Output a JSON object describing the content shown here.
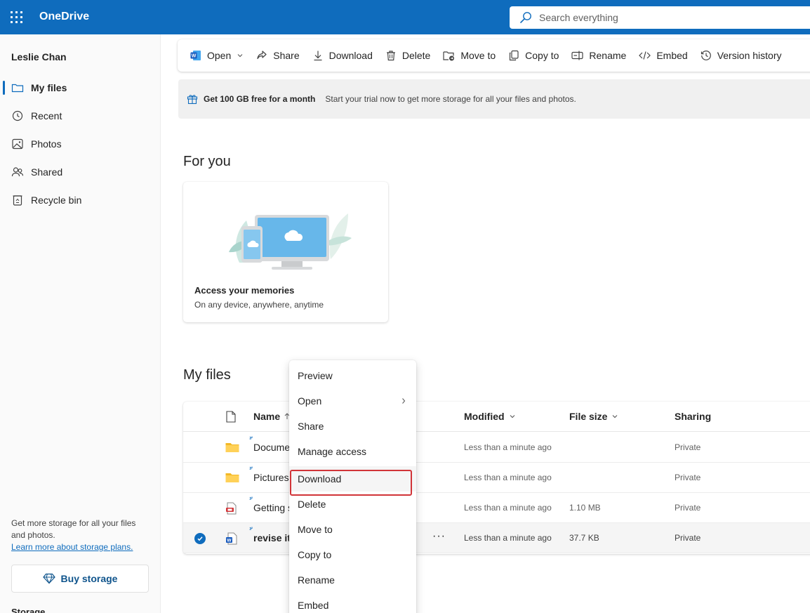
{
  "app": {
    "name": "OneDrive",
    "waffle_icon": "app-launcher-icon",
    "brand_color": "#0f6cbd"
  },
  "search": {
    "placeholder": "Search everything"
  },
  "sidebar": {
    "user_name": "Leslie Chan",
    "items": [
      {
        "label": "My files",
        "icon": "folder-icon",
        "active": true
      },
      {
        "label": "Recent",
        "icon": "history-icon",
        "active": false
      },
      {
        "label": "Photos",
        "icon": "image-icon",
        "active": false
      },
      {
        "label": "Shared",
        "icon": "people-icon",
        "active": false
      },
      {
        "label": "Recycle bin",
        "icon": "recycle-bin-icon",
        "active": false
      }
    ],
    "storage_text": "Get more storage for all your files and photos.",
    "storage_link": "Learn more about storage plans.",
    "buy_label": "Buy storage",
    "storage_heading": "Storage"
  },
  "toolbar": {
    "open": "Open",
    "share": "Share",
    "download": "Download",
    "delete": "Delete",
    "move_to": "Move to",
    "copy_to": "Copy to",
    "rename": "Rename",
    "embed": "Embed",
    "version_history": "Version history"
  },
  "banner": {
    "title": "Get 100 GB free for a month",
    "text": "Start your trial now to get more storage for all your files and photos."
  },
  "for_you": {
    "heading": "For you",
    "card_title": "Access your memories",
    "card_subtitle": "On any device, anywhere, anytime"
  },
  "my_files": {
    "heading": "My files",
    "columns": {
      "name": "Name",
      "modified": "Modified",
      "file_size": "File size",
      "sharing": "Sharing"
    },
    "rows": [
      {
        "name": "Docume",
        "type": "folder",
        "modified": "Less than a minute ago",
        "size": "",
        "sharing": "Private",
        "selected": false
      },
      {
        "name": "Pictures",
        "type": "folder",
        "modified": "Less than a minute ago",
        "size": "",
        "sharing": "Private",
        "selected": false
      },
      {
        "name": "Getting s",
        "type": "pdf",
        "modified": "Less than a minute ago",
        "size": "1.10 MB",
        "sharing": "Private",
        "selected": false
      },
      {
        "name": "revise it.",
        "type": "word",
        "modified": "Less than a minute ago",
        "size": "37.7 KB",
        "sharing": "Private",
        "selected": true
      }
    ],
    "more_label": "···"
  },
  "context_menu": {
    "items": [
      {
        "label": "Preview",
        "submenu": false,
        "highlighted": false
      },
      {
        "label": "Open",
        "submenu": true,
        "highlighted": false
      },
      {
        "label": "Share",
        "submenu": false,
        "highlighted": false
      },
      {
        "label": "Manage access",
        "submenu": false,
        "highlighted": false
      },
      {
        "label": "Download",
        "submenu": false,
        "highlighted": true
      },
      {
        "label": "Delete",
        "submenu": false,
        "highlighted": false
      },
      {
        "label": "Move to",
        "submenu": false,
        "highlighted": false
      },
      {
        "label": "Copy to",
        "submenu": false,
        "highlighted": false
      },
      {
        "label": "Rename",
        "submenu": false,
        "highlighted": false
      },
      {
        "label": "Embed",
        "submenu": false,
        "highlighted": false
      }
    ],
    "highlight_color": "#d13438"
  }
}
